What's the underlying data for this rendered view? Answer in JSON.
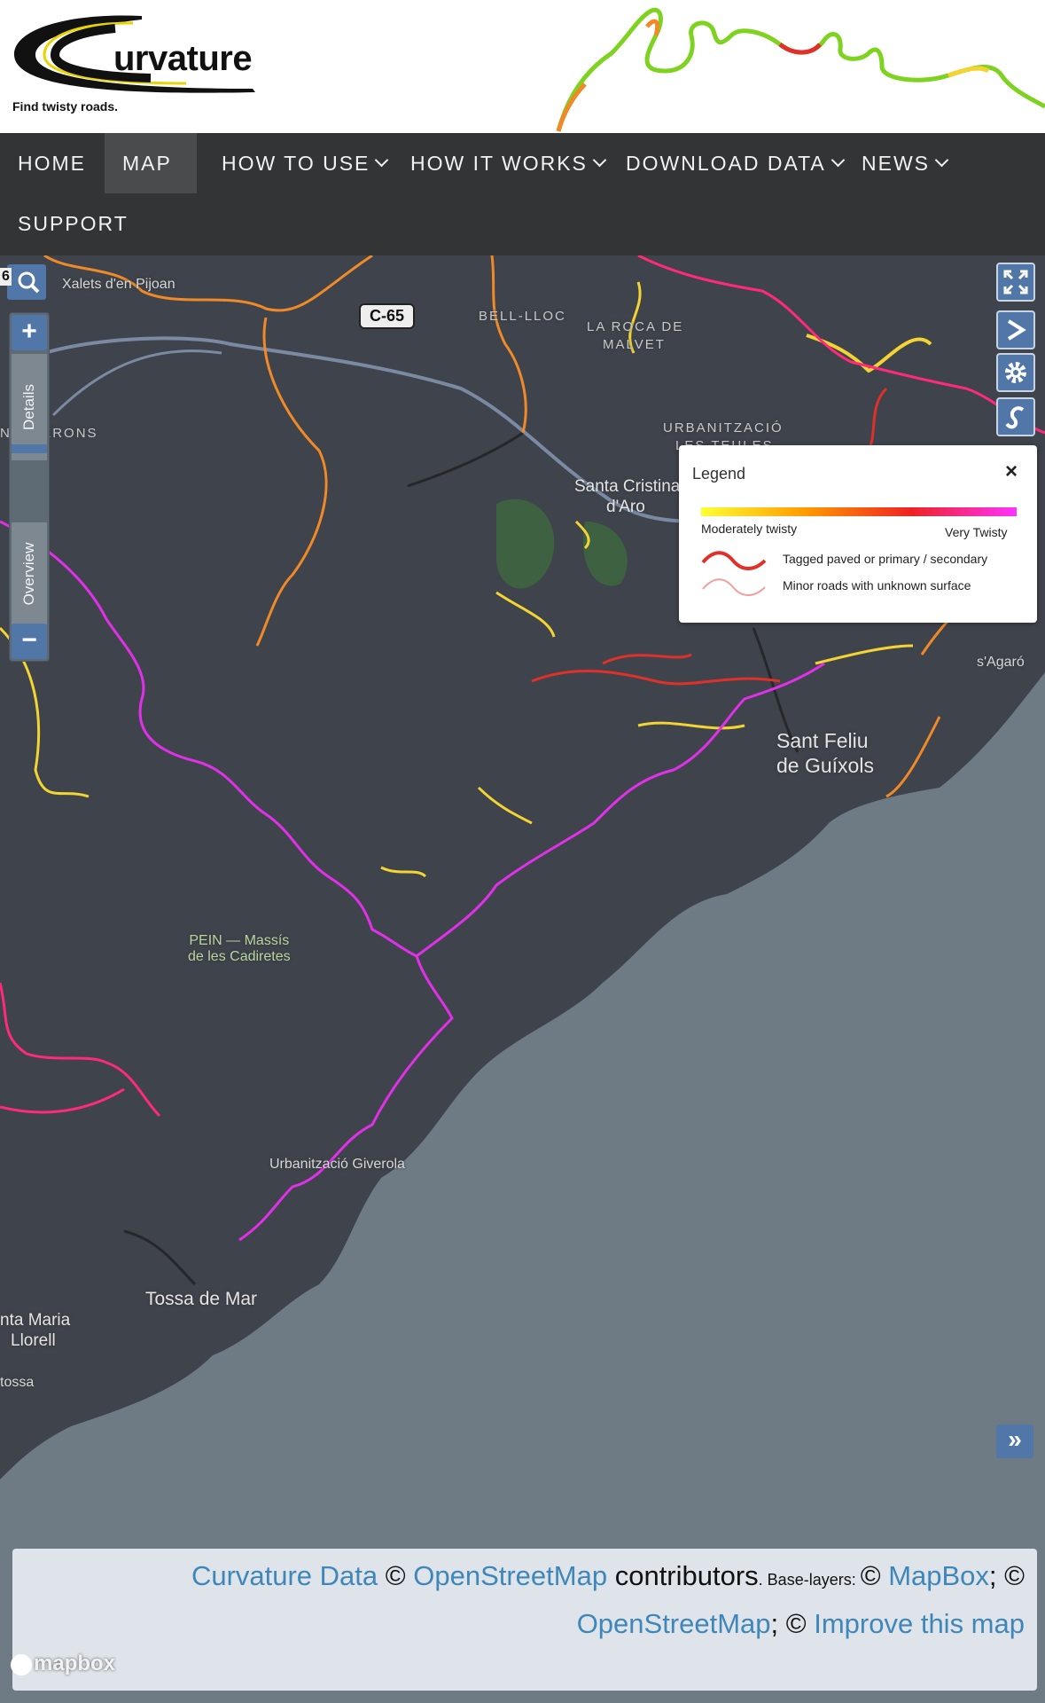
{
  "header": {
    "logo_text": "urvature",
    "tagline": "Find twisty roads."
  },
  "nav": {
    "items": [
      {
        "label": "HOME",
        "dropdown": false,
        "active": false
      },
      {
        "label": "MAP",
        "dropdown": false,
        "active": true
      },
      {
        "label": "HOW TO USE",
        "dropdown": true,
        "active": false
      },
      {
        "label": "HOW IT WORKS",
        "dropdown": true,
        "active": false
      },
      {
        "label": "DOWNLOAD DATA",
        "dropdown": true,
        "active": false
      },
      {
        "label": "NEWS",
        "dropdown": true,
        "active": false
      },
      {
        "label": "SUPPORT",
        "dropdown": false,
        "active": false
      }
    ]
  },
  "map": {
    "zoom_in": "+",
    "zoom_out": "−",
    "tab_details": "Details",
    "tab_overview": "Overview",
    "scale_fragment": "6",
    "road_shield": "C-65",
    "places": {
      "xalets": "Xalets d'en Pijoan",
      "bell_lloc": "BELL-LLOC",
      "roca": "LA ROCA DE",
      "malvet": "MALVET",
      "urban": "URBANITZACIÓ",
      "teules": "LES TEULES",
      "santa_cristina_1": "Santa Cristina",
      "santa_cristina_2": "d'Aro",
      "llerons": "NOLLERONS",
      "sagaro": "s'Agaró",
      "sant_feliu_1": "Sant Feliu",
      "sant_feliu_2": "de Guíxols",
      "pein_1": "PEIN — Massís",
      "pein_2": "de les Cadiretes",
      "giverola": "Urbanització Giverola",
      "tossa": "Tossa de Mar",
      "santa_maria_1": "nta Maria",
      "santa_maria_2": "Llorell",
      "tossa_frag": "tossa"
    },
    "legend": {
      "title": "Legend",
      "close": "×",
      "low": "Moderately twisty",
      "high": "Very Twisty",
      "row1": "Tagged paved or primary / secondary",
      "row2": "Minor roads with unknown surface"
    },
    "attribution": {
      "curvature_data": "Curvature Data",
      "copy1": " © ",
      "osm1": "OpenStreetMap",
      "contributors": " contributors",
      "base_layers": ". Base-layers: ",
      "copy2": "© ",
      "mapbox": "MapBox",
      "sep": "; © ",
      "osm2": "OpenStreetMap",
      "sep2": "; © ",
      "improve": "Improve this map"
    },
    "attribution_toggle": "»",
    "mapbox_logo": "mapbox",
    "colors": {
      "land": "#3f434c",
      "sea": "#6e7b85",
      "yellow": "#f3d433",
      "orange": "#f08a28",
      "red": "#e0302a",
      "magenta": "#e030e8",
      "pink": "#ff2a7a"
    }
  }
}
